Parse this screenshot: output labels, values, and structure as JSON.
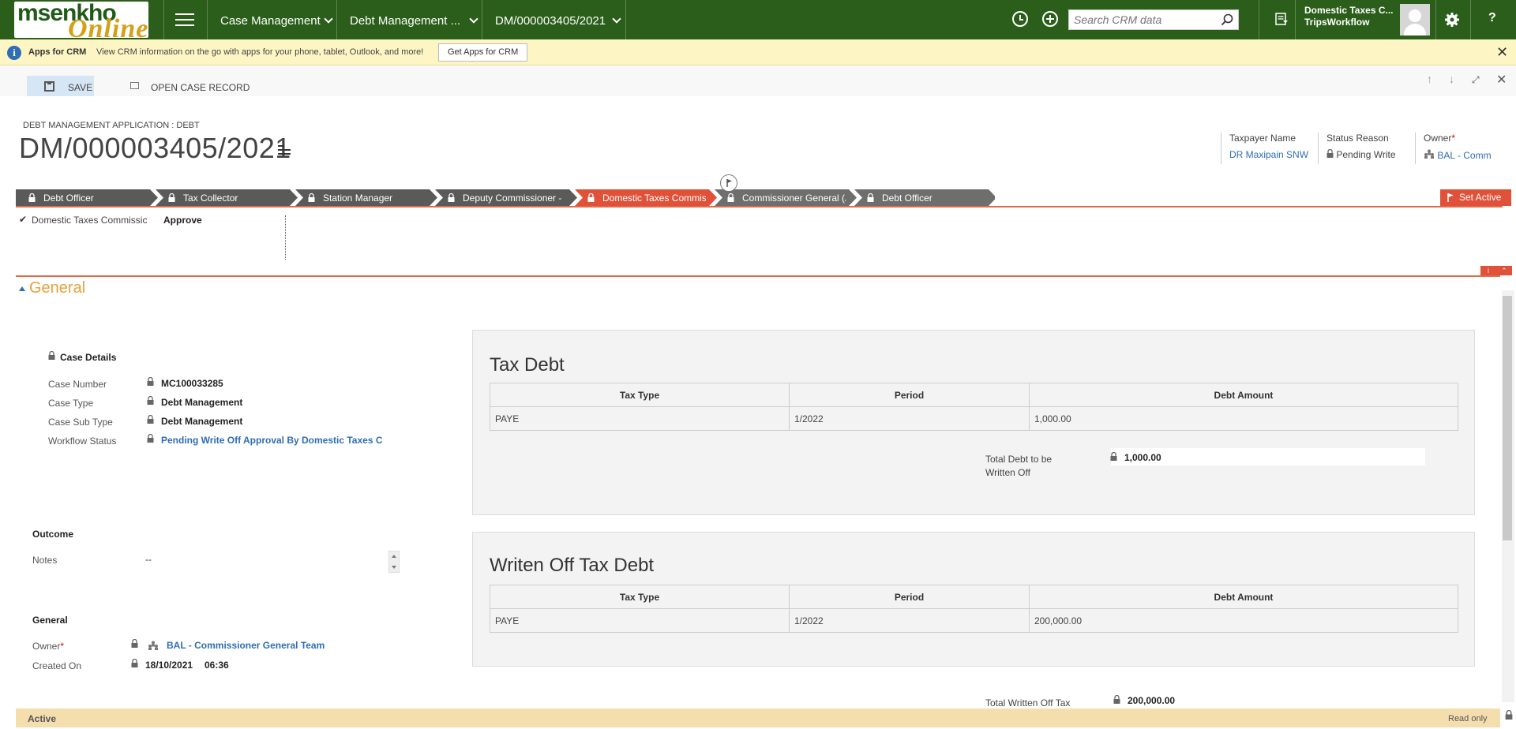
{
  "app": {
    "logo_text_1": "msenkho",
    "logo_text_2": "Online"
  },
  "nav": {
    "area": "Case Management",
    "entity": "Debt Management ...",
    "record": "DM/000003405/2021",
    "search_placeholder": "Search CRM data",
    "user_name": "Domestic Taxes C...",
    "user_org": "TripsWorkflow",
    "help": "?"
  },
  "notification": {
    "title": "Apps for CRM",
    "message": "View CRM information on the go with apps for your phone, tablet, Outlook, and more!",
    "button": "Get Apps for CRM",
    "close": "✕"
  },
  "command_bar": {
    "save": "SAVE",
    "open_case": "OPEN CASE RECORD"
  },
  "header": {
    "entity_label": "DEBT MANAGEMENT APPLICATION : DEBT",
    "title": "DM/000003405/2021",
    "fields": [
      {
        "label": "Taxpayer Name",
        "value": "DR Maxipain SNW"
      },
      {
        "label": "Status Reason",
        "value": "Pending Write"
      },
      {
        "label": "Owner",
        "value": "BAL - Comm"
      }
    ]
  },
  "process": {
    "stages": [
      {
        "label": "Debt Officer",
        "state": "done"
      },
      {
        "label": "Tax Collector",
        "state": "done"
      },
      {
        "label": "Station Manager",
        "state": "done"
      },
      {
        "label": "Deputy Commissioner - ",
        "state": "done"
      },
      {
        "label": "Domestic Taxes Commiss",
        "state": "active"
      },
      {
        "label": "Commissioner General (Ac",
        "state": "pending"
      },
      {
        "label": "Debt Officer",
        "state": "pending"
      }
    ],
    "set_active": "Set Active",
    "step_name": "Domestic Taxes Commissic",
    "step_value": "Approve",
    "colors": {
      "done": "#5a5a5a",
      "active": "#e0513a",
      "pending": "#6e6e6e"
    }
  },
  "section": {
    "title": "General"
  },
  "case_details": {
    "heading": "Case Details",
    "fields": [
      {
        "label": "Case Number",
        "value": "MC100033285"
      },
      {
        "label": "Case Type",
        "value": "Debt Management"
      },
      {
        "label": "Case Sub Type",
        "value": "Debt Management"
      },
      {
        "label": "Workflow Status",
        "value": "Pending Write Off Approval By Domestic Taxes C"
      }
    ]
  },
  "outcome": {
    "heading": "Outcome",
    "notes_label": "Notes",
    "notes_value": "--"
  },
  "general_sub": {
    "heading": "General",
    "owner_label": "Owner",
    "owner_value": "BAL - Commissioner General Team",
    "created_label": "Created On",
    "created_date": "18/10/2021",
    "created_time": "06:36"
  },
  "tax_debt": {
    "title": "Tax Debt",
    "columns": [
      "Tax Type",
      "Period",
      "Debt Amount"
    ],
    "rows": [
      [
        "PAYE",
        "1/2022",
        "1,000.00"
      ]
    ],
    "total_label_1": "Total Debt to be",
    "total_label_2": "Written Off",
    "total_value": "1,000.00"
  },
  "written_off": {
    "title": "Writen Off Tax Debt",
    "columns": [
      "Tax Type",
      "Period",
      "Debt Amount"
    ],
    "rows": [
      [
        "PAYE",
        "1/2022",
        "200,000.00"
      ]
    ],
    "total_label": "Total Written Off Tax",
    "total_value": "200,000.00"
  },
  "footer": {
    "status": "Active",
    "mode": "Read only"
  }
}
